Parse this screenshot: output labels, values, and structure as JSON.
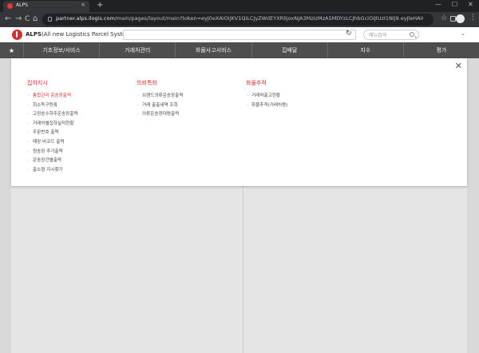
{
  "browser": {
    "tab_title": "ALPS",
    "tab_close": "×",
    "new_tab": "+",
    "win_min": "—",
    "win_max": "☐",
    "win_close": "✕",
    "back": "←",
    "forward": "→",
    "reload": "C",
    "home": "⌂",
    "url_host": "partner.alps.ilogis.com",
    "url_path": "/main/pages/layout/main?token=eyJ0eXAiOiJKV1QiLCJyZWdEYXRlIjoxNjA3MzIzMzA5MDYzLCJhbGciOiJIUzI1NiJ9.eyJleHAiOjE2MDcz...",
    "star": "☆",
    "kebab": "⋮"
  },
  "header": {
    "logo_name": "ALPS",
    "logo_tagline": "(All new Logistics Parcel System)",
    "refresh": "↻",
    "search_placeholder": "메뉴검색",
    "chevron": "⌄"
  },
  "menu": {
    "star": "★",
    "items": [
      "기초정보/서비스",
      "거래처관리",
      "화물사고서비스",
      "집배달",
      "지수",
      "평가"
    ]
  },
  "dropdown": {
    "close": "✕",
    "columns": [
      {
        "title": "집하지시",
        "items": [
          "통합관리 운송장출력",
          "회소독구등록",
          "고정송수하주운송장출력",
          "거래처별집하실적현황",
          "주문번호 출력",
          "매장 바코드 출력",
          "원송장 추가출력",
          "운송장건별출력",
          "출소형 지시찾기"
        ],
        "active_index": 0
      },
      {
        "title": "의뢰특화",
        "items": [
          "브랜드의류운송장출력",
          "거래 출출내역 조회",
          "의류운송장대량출력"
        ]
      },
      {
        "title": "화물추적",
        "items": [
          "거래처출고현황",
          "화물추적(거래처용)"
        ]
      }
    ]
  },
  "colors": {
    "accent": "#d32f2f",
    "menubar": "#4e4e4e",
    "background": "#d9d9d9"
  }
}
